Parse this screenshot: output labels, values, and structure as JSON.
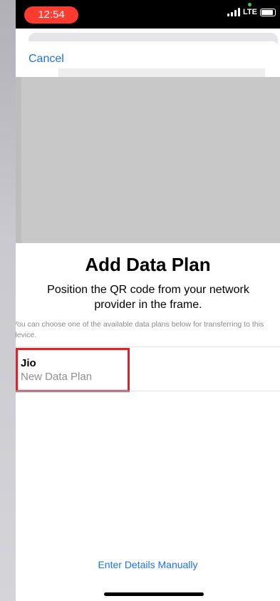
{
  "status_bar": {
    "time": "12:54",
    "network": "LTE"
  },
  "sheet": {
    "cancel_label": "Cancel",
    "title": "Add Data Plan",
    "subtitle": "Position the QR code from your network provider in the frame.",
    "hint": "You can choose one of the available data plans below for transferring to this device.",
    "plans": [
      {
        "name": "Jio",
        "description": "New Data Plan"
      }
    ],
    "manual_label": "Enter Details Manually"
  },
  "colors": {
    "accent": "#1a73e8",
    "time_pill": "#ff3b30",
    "highlight": "#e0202a"
  }
}
